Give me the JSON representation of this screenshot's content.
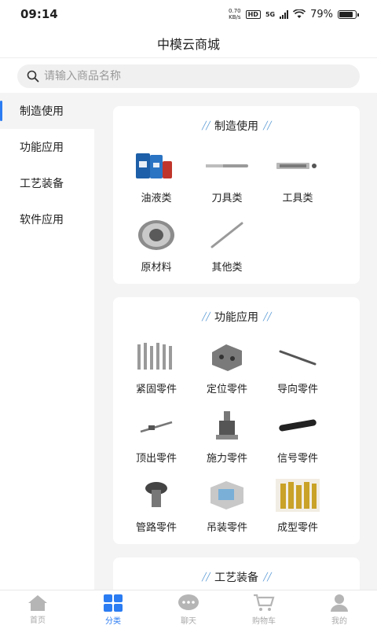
{
  "status": {
    "time": "09:14",
    "net_speed_top": "0.70",
    "net_speed_bottom": "KB/s",
    "hd": "HD",
    "network": "5G",
    "battery": "79%"
  },
  "header": {
    "title": "中模云商城"
  },
  "search": {
    "placeholder": "请输入商品名称"
  },
  "sidebar": {
    "items": [
      {
        "label": "制造使用"
      },
      {
        "label": "功能应用"
      },
      {
        "label": "工艺装备"
      },
      {
        "label": "软件应用"
      }
    ]
  },
  "sections": [
    {
      "title": "制造使用",
      "items": [
        {
          "label": "油液类",
          "icon": "oil-barrels-icon"
        },
        {
          "label": "刀具类",
          "icon": "cutting-tool-icon"
        },
        {
          "label": "工具类",
          "icon": "tool-set-icon"
        },
        {
          "label": "原材料",
          "icon": "metal-ring-icon"
        },
        {
          "label": "其他类",
          "icon": "rod-icon"
        }
      ]
    },
    {
      "title": "功能应用",
      "items": [
        {
          "label": "紧固零件",
          "icon": "screws-icon"
        },
        {
          "label": "定位零件",
          "icon": "locator-block-icon"
        },
        {
          "label": "导向零件",
          "icon": "guide-pin-icon"
        },
        {
          "label": "顶出零件",
          "icon": "ejector-pin-icon"
        },
        {
          "label": "施力零件",
          "icon": "press-unit-icon"
        },
        {
          "label": "信号零件",
          "icon": "signal-bar-icon"
        },
        {
          "label": "管路零件",
          "icon": "pipe-fitting-icon"
        },
        {
          "label": "吊装零件",
          "icon": "lifting-frame-icon"
        },
        {
          "label": "成型零件",
          "icon": "molding-pins-icon"
        }
      ]
    },
    {
      "title": "工艺装备",
      "items": []
    }
  ],
  "tabbar": {
    "items": [
      {
        "label": "首页",
        "icon": "home-icon"
      },
      {
        "label": "分类",
        "icon": "grid-icon"
      },
      {
        "label": "聊天",
        "icon": "chat-icon"
      },
      {
        "label": "购物车",
        "icon": "cart-icon"
      },
      {
        "label": "我的",
        "icon": "user-icon"
      }
    ]
  },
  "colors": {
    "accent": "#2b7cf2",
    "decoration": "#5b9bd5",
    "content_bg": "#f4f4f4"
  }
}
